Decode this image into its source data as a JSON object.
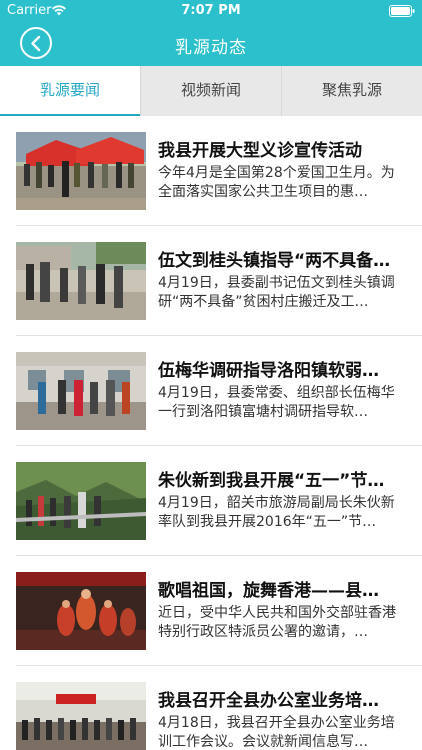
{
  "status_bar": {
    "carrier": "Carrier",
    "time": "7:07 PM"
  },
  "nav": {
    "title": "乳源动态",
    "back_icon": "chevron-left-icon"
  },
  "tabs": [
    {
      "label": "乳源要闻",
      "active": true
    },
    {
      "label": "视频新闻",
      "active": false
    },
    {
      "label": "聚焦乳源",
      "active": false
    }
  ],
  "news": [
    {
      "title": "我县开展大型义诊宣传活动",
      "summary": "今年4月是全国第28个爱国卫生月。为全面落实国家公共卫生项目的惠…"
    },
    {
      "title": "伍文到桂头镇指导“两不具备…",
      "summary": "4月19日，县委副书记伍文到桂头镇调研“两不具备”贫困村庄搬迁及工…"
    },
    {
      "title": "伍梅华调研指导洛阳镇软弱…",
      "summary": "4月19日，县委常委、组织部长伍梅华一行到洛阳镇富塘村调研指导软…"
    },
    {
      "title": "朱伙新到我县开展“五一”节…",
      "summary": "4月19日，韶关市旅游局副局长朱伙新率队到我县开展2016年“五一”节…"
    },
    {
      "title": "歌唱祖国，旋舞香港——县…",
      "summary": "近日，受中华人民共和国外交部驻香港特别行政区特派员公署的邀请，…"
    },
    {
      "title": "我县召开全县办公室业务培…",
      "summary": "4月18日，我县召开全县办公室业务培训工作会议。会议就新闻信息写…"
    }
  ]
}
